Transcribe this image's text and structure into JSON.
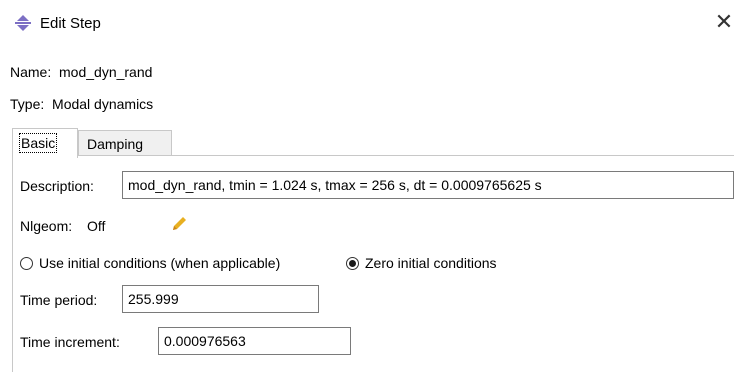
{
  "window": {
    "title": "Edit Step",
    "title_icon": "step-diamond-icon",
    "close_glyph": "✕"
  },
  "step": {
    "name_label": "Name:",
    "name_value": "mod_dyn_rand",
    "type_label": "Type:",
    "type_value": "Modal dynamics"
  },
  "tabs": [
    {
      "label": "Basic",
      "active": true
    },
    {
      "label": "Damping",
      "active": false
    }
  ],
  "basic": {
    "description_label": "Description:",
    "description_value": "mod_dyn_rand, tmin = 1.024 s, tmax = 256 s, dt = 0.0009765625 s",
    "nlgeom_label": "Nlgeom:",
    "nlgeom_value": "Off",
    "nlgeom_edit_icon": "pencil-icon",
    "initial_conditions": [
      {
        "label": "Use initial conditions (when applicable)",
        "selected": false
      },
      {
        "label": "Zero initial conditions",
        "selected": true
      }
    ],
    "time_period_label": "Time period:",
    "time_period_value": "255.999",
    "time_increment_label": "Time increment:",
    "time_increment_value": "0.000976563"
  },
  "colors": {
    "icon_fill": "#7c6fc4",
    "pencil_fill": "#e8b021",
    "border": "#7a7a7a"
  }
}
